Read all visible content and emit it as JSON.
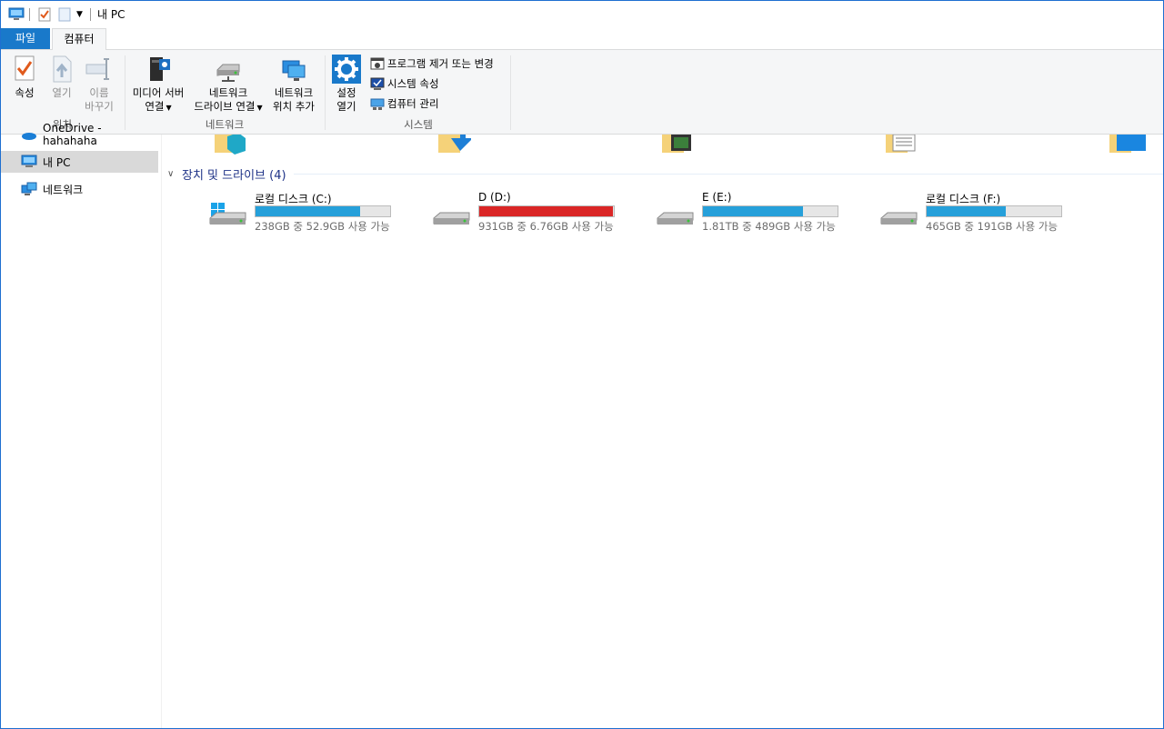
{
  "window": {
    "title": "내 PC"
  },
  "tabs": {
    "file": "파일",
    "computer": "컴퓨터"
  },
  "ribbon": {
    "location": {
      "label": "위치",
      "properties": "속성",
      "open": "열기",
      "rename_1": "이름",
      "rename_2": "바꾸기"
    },
    "network": {
      "label": "네트워크",
      "media_1": "미디어 서버",
      "media_2": "연결",
      "map_1": "네트워크",
      "map_2": "드라이브 연결",
      "add_1": "네트워크",
      "add_2": "위치 추가"
    },
    "system": {
      "label": "시스템",
      "settings_1": "설정",
      "settings_2": "열기",
      "uninstall": "프로그램 제거 또는 변경",
      "sysprops": "시스템 속성",
      "manage": "컴퓨터 관리"
    }
  },
  "nav": {
    "onedrive": "OneDrive - hahahaha",
    "this_pc": "내 PC",
    "network": "네트워크"
  },
  "content": {
    "group_title": "장치 및 드라이브 (4)",
    "drives": [
      {
        "name": "로컬 디스크 (C:)",
        "free_text": "238GB 중 52.9GB 사용 가능",
        "used_fraction": 0.78,
        "bar_color": "#26a0da",
        "os_drive": true
      },
      {
        "name": "D (D:)",
        "free_text": "931GB 중 6.76GB 사용 가능",
        "used_fraction": 0.99,
        "bar_color": "#da2626",
        "os_drive": false
      },
      {
        "name": "E (E:)",
        "free_text": "1.81TB 중 489GB 사용 가능",
        "used_fraction": 0.74,
        "bar_color": "#26a0da",
        "os_drive": false
      },
      {
        "name": "로컬 디스크 (F:)",
        "free_text": "465GB 중 191GB 사용 가능",
        "used_fraction": 0.59,
        "bar_color": "#26a0da",
        "os_drive": false
      }
    ]
  }
}
